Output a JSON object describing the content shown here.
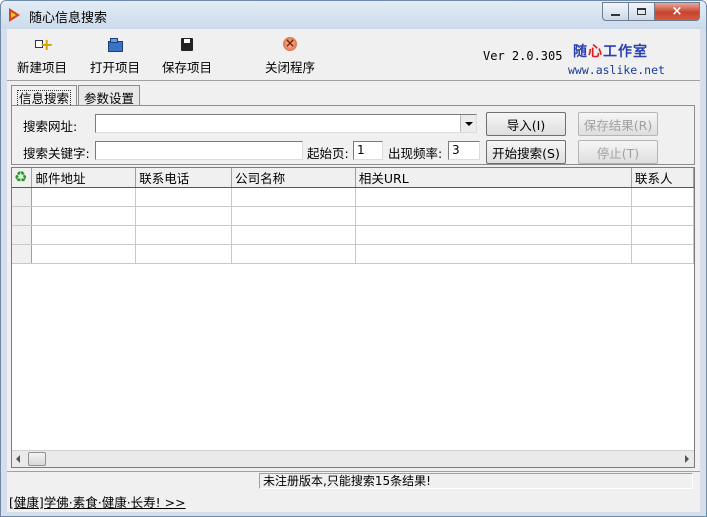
{
  "window": {
    "title": "随心信息搜索",
    "close_glyph": "×"
  },
  "toolbar": {
    "new_label": "新建项目",
    "open_label": "打开项目",
    "save_label": "保存项目",
    "exit_label": "关闭程序",
    "version": "Ver 2.0.305",
    "brand_left": "随",
    "brand_heart": "心",
    "brand_right": "工作室",
    "brand_url": "www.aslike.net"
  },
  "tabs": [
    {
      "label": "信息搜索",
      "active": true
    },
    {
      "label": "参数设置",
      "active": false
    }
  ],
  "search": {
    "url_label": "搜索网址:",
    "url_value": "",
    "keyword_label": "搜索关键字:",
    "keyword_value": "",
    "start_page_label": "起始页:",
    "start_page_value": "1",
    "frequency_label": "出现频率:",
    "frequency_value": "3",
    "import_label": "导入(I)",
    "start_label": "开始搜索(S)",
    "save_results_label": "保存结果(R)",
    "stop_label": "停止(T)"
  },
  "grid": {
    "columns": [
      "邮件地址",
      "联系电话",
      "公司名称",
      "相关URL",
      "联系人"
    ],
    "rows": [
      [
        "",
        "",
        "",
        "",
        ""
      ],
      [
        "",
        "",
        "",
        "",
        ""
      ],
      [
        "",
        "",
        "",
        "",
        ""
      ],
      [
        "",
        "",
        "",
        "",
        ""
      ]
    ]
  },
  "status": {
    "message": "未注册版本,只能搜索15条结果!"
  },
  "ad": {
    "text": "[健康]学佛·素食·健康·长寿! >>"
  },
  "colors": {
    "title_bar": "#cbdaea",
    "close_button": "#c7432e",
    "brand": "#2a3fb0",
    "brand_heart": "#e01a1a"
  }
}
